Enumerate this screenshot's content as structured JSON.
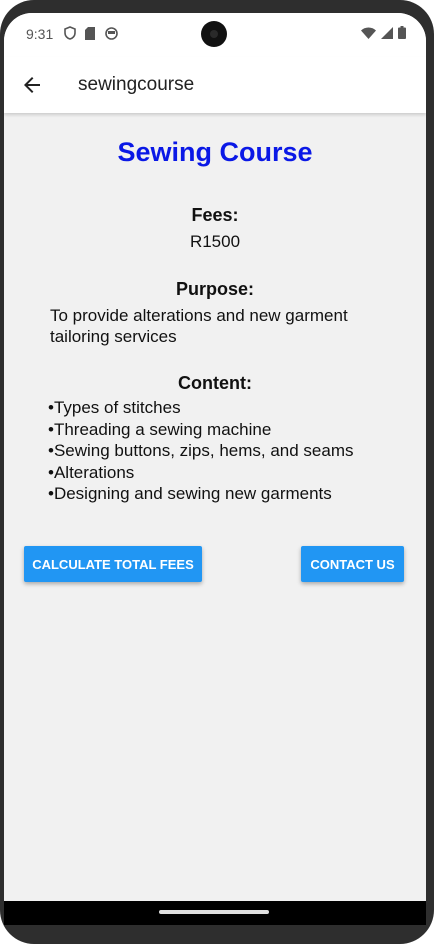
{
  "status_bar": {
    "time": "9:31",
    "left_icons": [
      "shield-icon",
      "sd-card-icon",
      "circle-face-icon"
    ],
    "right_icons": [
      "wifi-icon",
      "signal-icon",
      "battery-icon"
    ]
  },
  "app_bar": {
    "title": "sewingcourse",
    "back_icon": "arrow-left-icon"
  },
  "course": {
    "title": "Sewing Course",
    "fees_label": "Fees:",
    "fees_value": "R1500",
    "purpose_label": "Purpose:",
    "purpose_text": "To provide alterations and new garment tailoring services",
    "content_label": "Content:",
    "content_items": [
      "Types of stitches",
      "Threading a sewing machine",
      "Sewing buttons, zips, hems, and seams",
      "Alterations",
      "Designing and sewing new garments"
    ]
  },
  "buttons": {
    "calculate": "CALCULATE TOTAL FEES",
    "contact": "CONTACT US"
  },
  "colors": {
    "title": "#0a18e6",
    "button": "#2196f3",
    "background": "#f1f1f1"
  }
}
